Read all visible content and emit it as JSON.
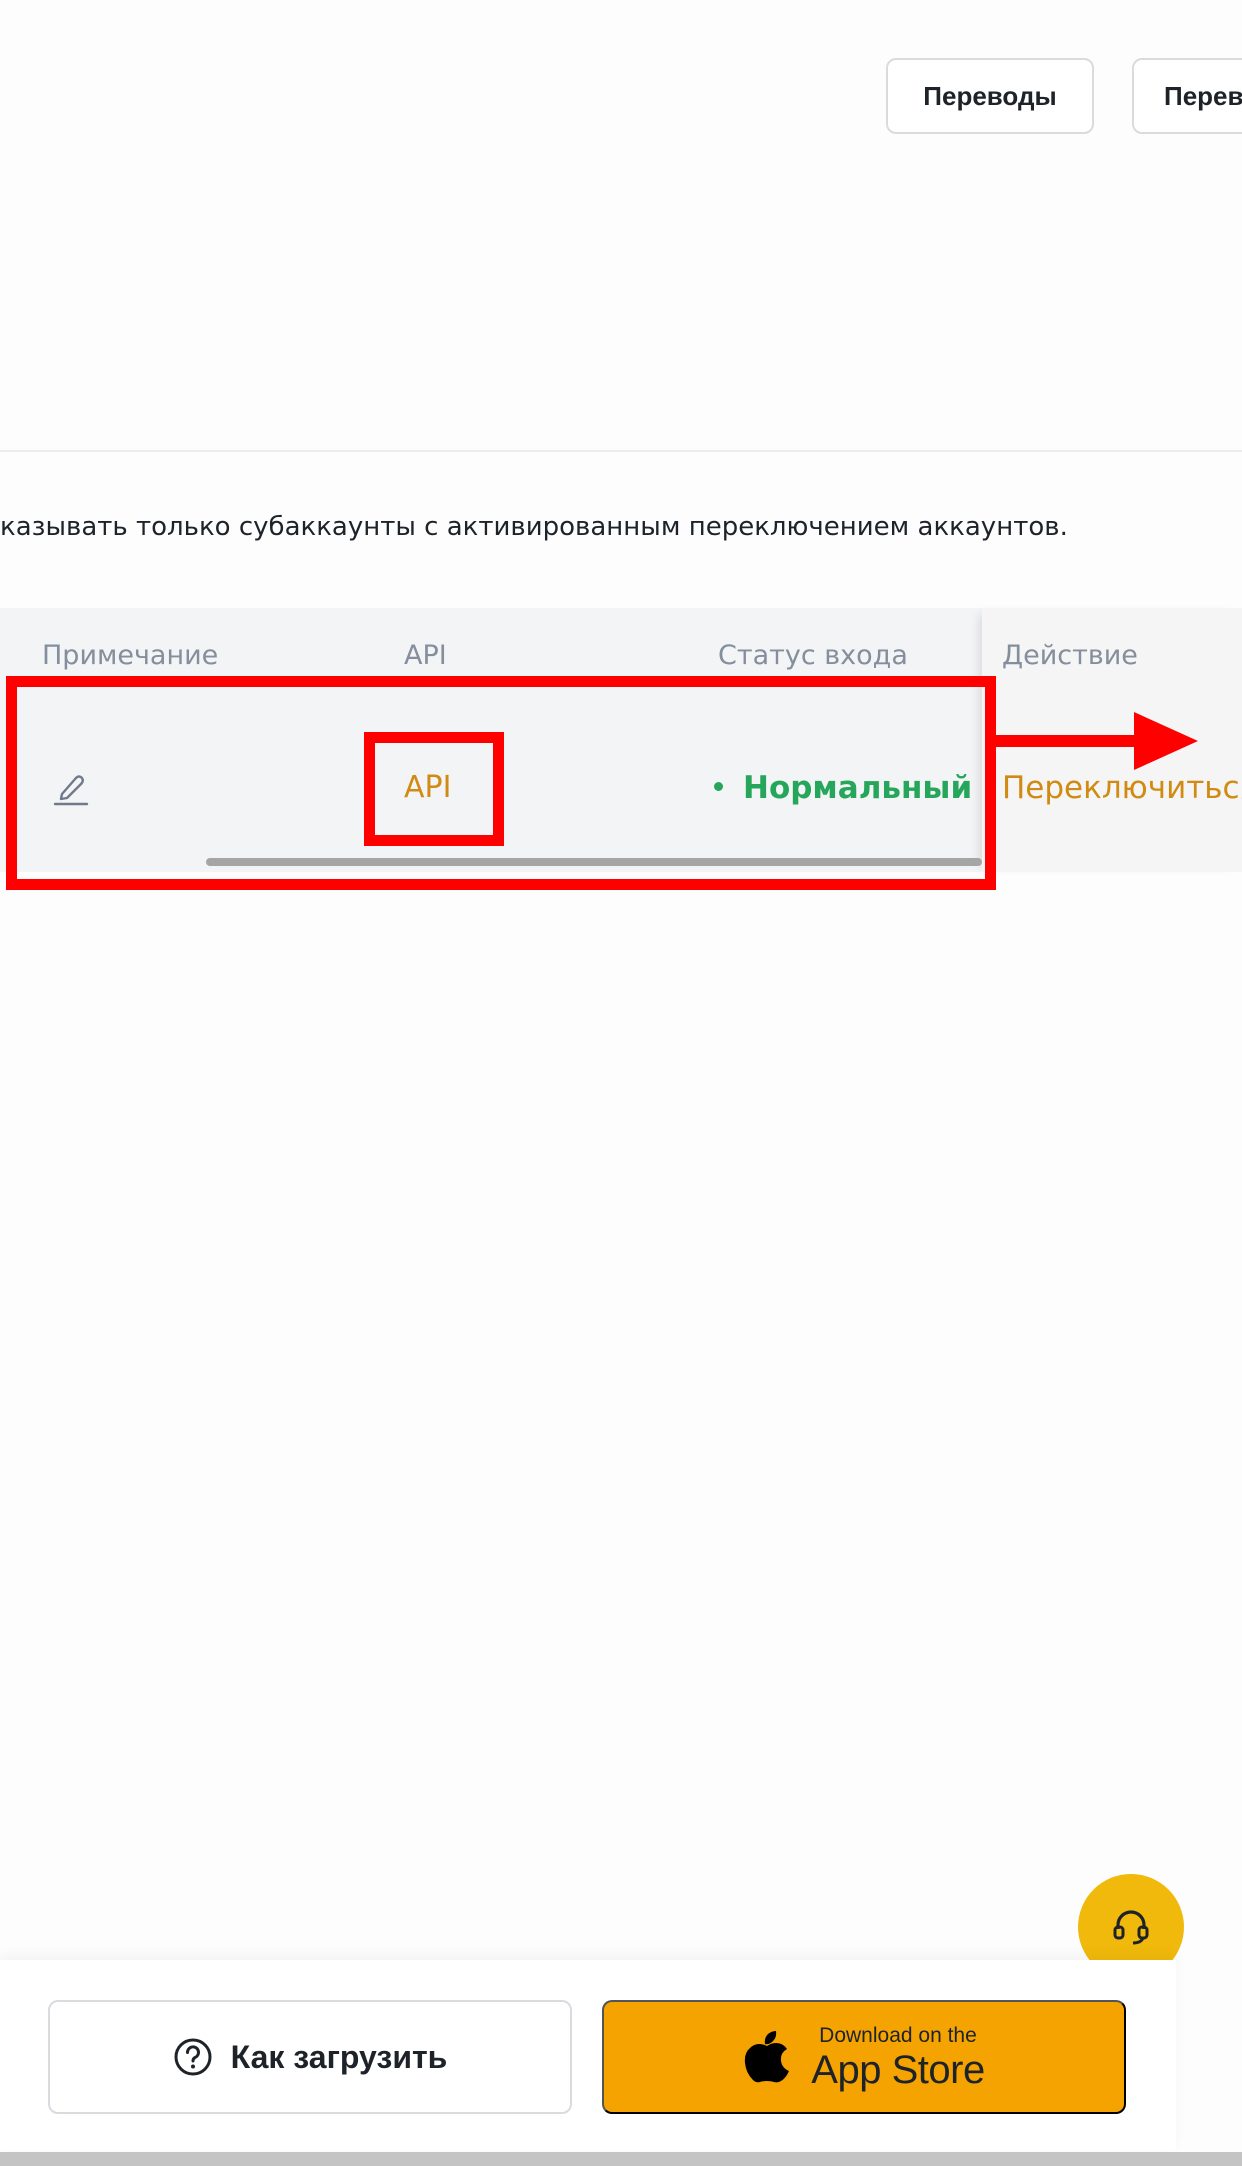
{
  "header": {
    "buttons": [
      {
        "label": "Переводы"
      },
      {
        "label": "Переводы"
      }
    ]
  },
  "filter": {
    "note": "казывать только субаккаунты с активированным переключением аккаунтов."
  },
  "table": {
    "columns": [
      "Примечание",
      "API",
      "Статус входа",
      "Действие"
    ],
    "rows": [
      {
        "api_link": "API",
        "status": "Нормальный",
        "action": "Переключиться"
      }
    ]
  },
  "footer": {
    "how_to_label": "Как загрузить",
    "appstore_small": "Download on the",
    "appstore_big": "App Store"
  },
  "colors": {
    "accent": "#f0b90b",
    "link": "#d18b12",
    "status_ok": "#26a65b",
    "annotation": "#ff0000"
  }
}
